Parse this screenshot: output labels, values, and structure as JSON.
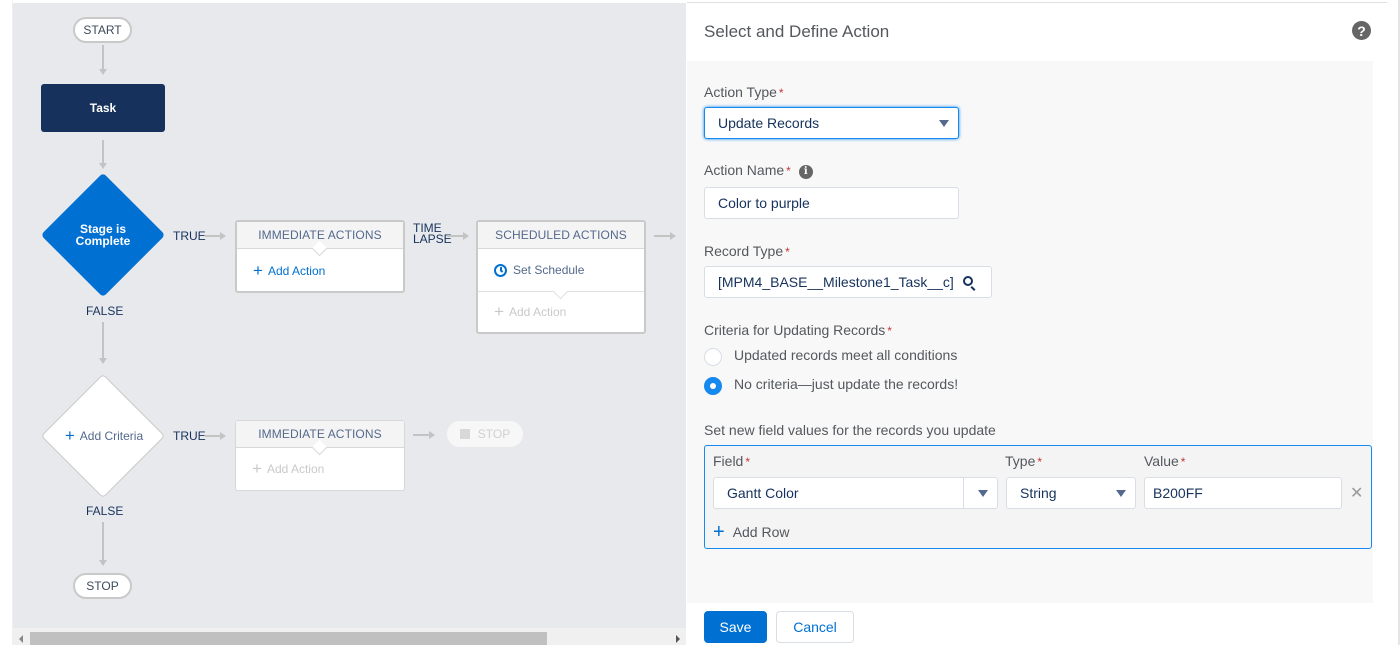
{
  "flow": {
    "start_label": "START",
    "task_label": "Task",
    "criteria_1": {
      "label_line1": "Stage is",
      "label_line2": "Complete",
      "true_label": "TRUE",
      "false_label": "FALSE"
    },
    "immediate_actions_1": {
      "header": "IMMEDIATE ACTIONS",
      "add_action": "Add Action"
    },
    "time_lapse_label_line1": "TIME",
    "time_lapse_label_line2": "LAPSE",
    "scheduled_actions": {
      "header": "SCHEDULED ACTIONS",
      "set_schedule": "Set Schedule",
      "add_action": "Add Action"
    },
    "criteria_2": {
      "add_criteria": "Add Criteria",
      "true_label": "TRUE",
      "false_label": "FALSE"
    },
    "immediate_actions_2": {
      "header": "IMMEDIATE ACTIONS",
      "add_action": "Add Action"
    },
    "stop_faded_label": "STOP",
    "stop_label": "STOP"
  },
  "panel": {
    "title": "Select and Define Action",
    "help_icon": "?",
    "required_marker": "*",
    "action_type": {
      "label": "Action Type",
      "value": "Update Records"
    },
    "action_name": {
      "label": "Action Name",
      "info_icon": "i",
      "value": "Color to purple"
    },
    "record_type": {
      "label": "Record Type",
      "value": "[MPM4_BASE__Milestone1_Task__c]"
    },
    "criteria": {
      "label": "Criteria for Updating Records",
      "options": [
        {
          "label": "Updated records meet all conditions",
          "checked": false
        },
        {
          "label": "No criteria—just update the records!",
          "checked": true
        }
      ]
    },
    "field_values": {
      "label": "Set new field values for the records you update",
      "columns": {
        "field": "Field",
        "type": "Type",
        "value": "Value"
      },
      "rows": [
        {
          "field": "Gantt Color",
          "type": "String",
          "value": "B200FF"
        }
      ],
      "remove_icon": "✕",
      "add_row": "Add Row"
    },
    "save_label": "Save",
    "cancel_label": "Cancel"
  }
}
